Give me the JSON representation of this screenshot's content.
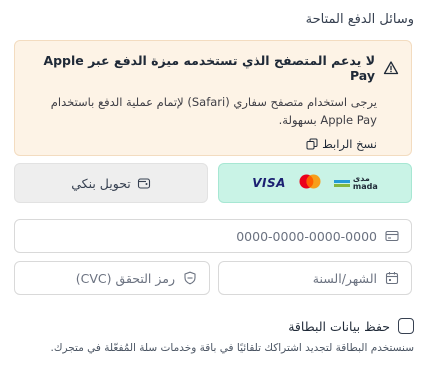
{
  "payment": {
    "section_title": "وسائل الدفع المتاحة",
    "alert": {
      "title": "لا يدعم المتصفح الذي تستخدمه ميزة الدفع عبر Apple Pay",
      "body": "يرجى استخدام متصفح سفاري (Safari) لإتمام عملية الدفع باستخدام Apple Pay بسهولة.",
      "copy_link": "نسخ الرابط",
      "icon": "warning-icon",
      "bg_color": "#fdf3e6"
    },
    "methods": {
      "cards": {
        "visa": "VISA",
        "mada_top": "مدى",
        "mada_bottom": "mada",
        "selected": true,
        "bg_color": "#c9f3e6"
      },
      "bank": {
        "label": "تحويل بنكي",
        "icon": "bank-transfer-icon"
      }
    },
    "fields": {
      "card_number": {
        "placeholder": "0000-0000-0000-0000",
        "icon": "credit-card-icon"
      },
      "expiry": {
        "placeholder": "الشهر/السنة",
        "icon": "calendar-icon"
      },
      "cvc": {
        "placeholder": "رمز التحقق (CVC)",
        "icon": "shield-icon"
      }
    },
    "save_card": {
      "label": "حفظ بيانات البطاقة",
      "description": "سنستخدم البطاقة لتجديد اشتراكك تلقائيًا في باقة وخدمات سلة المُفعّلة في متجرك.",
      "checked": false
    }
  }
}
